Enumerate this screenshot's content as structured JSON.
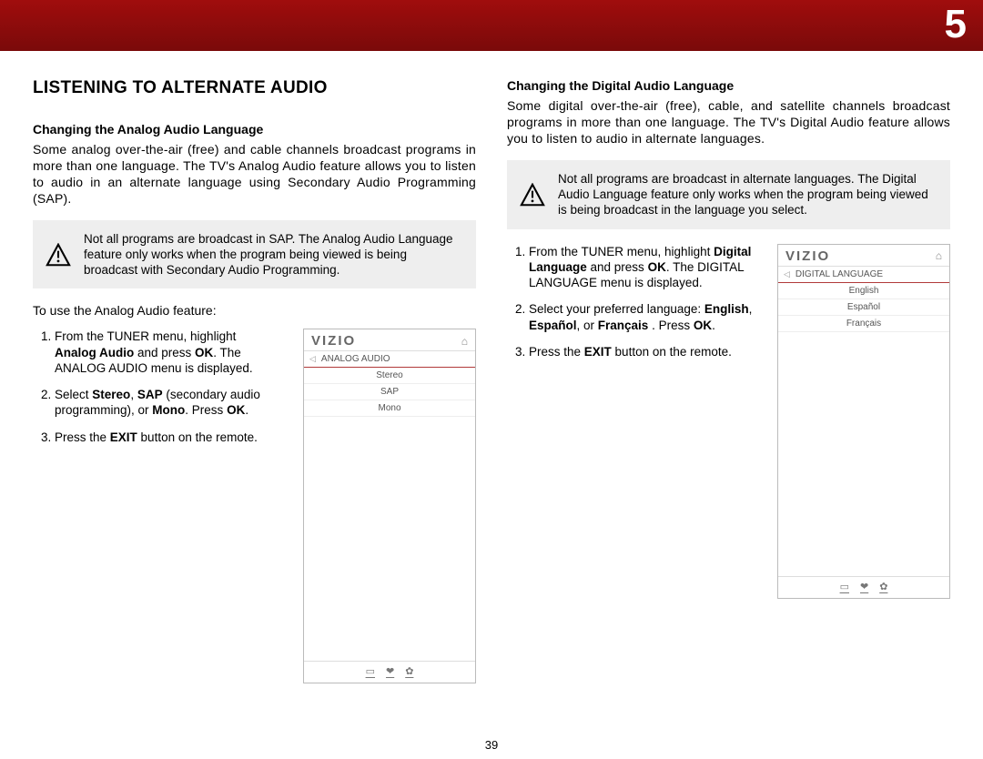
{
  "chapter_number": "5",
  "page_number": "39",
  "left": {
    "section_title": "LISTENING TO ALTERNATE AUDIO",
    "sub_title": "Changing the Analog Audio Language",
    "para1": "Some analog over-the-air (free) and cable channels broadcast programs in more than one language. The TV's Analog Audio feature allows you to listen to audio in an alternate language using Secondary Audio Programming (SAP).",
    "note": "Not all programs are broadcast in SAP. The Analog Audio Language feature only works when the program being viewed is being broadcast with Secondary Audio Programming.",
    "intro": "To use the Analog Audio feature:",
    "steps": [
      {
        "pre": "From the TUNER menu, highlight ",
        "b1": "Analog Audio",
        "mid": " and press ",
        "b2": "OK",
        "post": ". The ANALOG AUDIO menu is displayed."
      },
      {
        "pre": "Select ",
        "b1": "Stereo",
        "mid": ", ",
        "b2": "SAP",
        "mid2": " (secondary audio programming), or ",
        "b3": "Mono",
        "post": ". Press ",
        "b4": "OK",
        "post2": "."
      },
      {
        "pre": "Press the ",
        "b1": "EXIT",
        "post": " button on the remote."
      }
    ],
    "device": {
      "brand": "VIZIO",
      "menu_title": "ANALOG AUDIO",
      "items": [
        "Stereo",
        "SAP",
        "Mono"
      ]
    }
  },
  "right": {
    "sub_title": "Changing the Digital Audio Language",
    "para1": "Some digital over-the-air (free), cable, and satellite channels broadcast programs in more than one language. The TV's Digital Audio feature allows you to listen to audio in alternate languages.",
    "note": "Not all programs are broadcast in alternate languages. The Digital Audio Language feature only works when the program being viewed is being broadcast in the language you select.",
    "steps": [
      {
        "pre": "From the TUNER menu, highlight ",
        "b1": "Digital Language",
        "mid": " and press ",
        "b2": "OK",
        "post": ". The DIGITAL LANGUAGE menu is displayed."
      },
      {
        "pre": "Select your preferred language: ",
        "b1": "English",
        "mid": ", ",
        "b2": "Español",
        "mid2": ",  or ",
        "b3": "Français",
        "post": " . Press ",
        "b4": "OK",
        "post2": "."
      },
      {
        "pre": "Press the ",
        "b1": "EXIT",
        "post": " button on the remote."
      }
    ],
    "device": {
      "brand": "VIZIO",
      "menu_title": "DIGITAL LANGUAGE",
      "items": [
        "English",
        "Español",
        "Français"
      ]
    }
  }
}
